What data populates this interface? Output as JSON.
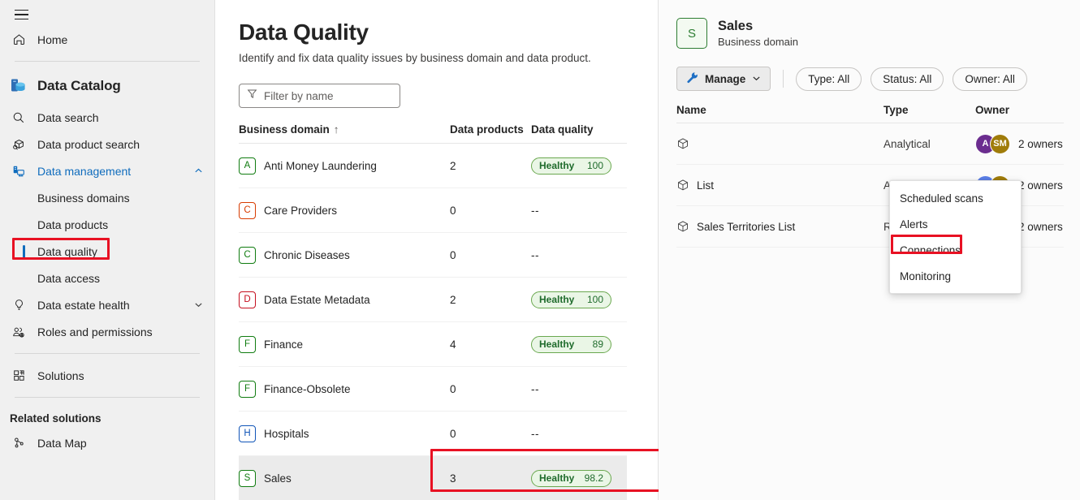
{
  "sidebar": {
    "hamburger": "menu-icon",
    "home": {
      "label": "Home",
      "icon": "home-icon"
    },
    "brand": {
      "label": "Data Catalog",
      "icon": "data-catalog-icon"
    },
    "items": [
      {
        "label": "Data search",
        "icon": "search-icon"
      },
      {
        "label": "Data product search",
        "icon": "data-product-icon"
      },
      {
        "label": "Data management",
        "icon": "data-management-icon",
        "expanded": true,
        "chevron": "chevron-up-icon"
      },
      {
        "label": "Business domains",
        "sub": true
      },
      {
        "label": "Data products",
        "sub": true
      },
      {
        "label": "Data quality",
        "sub": true,
        "selected": true,
        "highlighted": true
      },
      {
        "label": "Data access",
        "sub": true
      },
      {
        "label": "Data estate health",
        "icon": "lightbulb-icon",
        "chevron": "chevron-down-icon"
      },
      {
        "label": "Roles and permissions",
        "icon": "roles-icon"
      },
      {
        "label": "Solutions",
        "icon": "solutions-icon"
      }
    ],
    "related_solutions_header": "Related solutions",
    "related_items": [
      {
        "label": "Data Map",
        "icon": "data-map-icon"
      }
    ]
  },
  "main": {
    "title": "Data Quality",
    "subtitle": "Identify and fix data quality issues by business domain and data product.",
    "filter": {
      "placeholder": "Filter by name",
      "icon": "filter-icon",
      "value": ""
    },
    "table": {
      "columns": [
        "Business domain",
        "Data products",
        "Data quality"
      ],
      "sort_indicator": "↑",
      "rows": [
        {
          "initial": "A",
          "color": "#107c10",
          "name": "Anti Money Laundering",
          "products": "2",
          "status": "Healthy",
          "score": "100"
        },
        {
          "initial": "C",
          "color": "#d83b01",
          "name": "Care Providers",
          "products": "0",
          "status": "",
          "score": "",
          "quality": "--"
        },
        {
          "initial": "C",
          "color": "#107c10",
          "name": "Chronic Diseases",
          "products": "0",
          "status": "",
          "score": "",
          "quality": "--"
        },
        {
          "initial": "D",
          "color": "#c50f1f",
          "name": "Data Estate Metadata",
          "products": "2",
          "status": "Healthy",
          "score": "100"
        },
        {
          "initial": "F",
          "color": "#107c10",
          "name": "Finance",
          "products": "4",
          "status": "Healthy",
          "score": "89"
        },
        {
          "initial": "F",
          "color": "#107c10",
          "name": "Finance-Obsolete",
          "products": "0",
          "status": "",
          "score": "",
          "quality": "--"
        },
        {
          "initial": "H",
          "color": "#1155b8",
          "name": "Hospitals",
          "products": "0",
          "status": "",
          "score": "",
          "quality": "--"
        },
        {
          "initial": "S",
          "color": "#107c10",
          "name": "Sales",
          "products": "3",
          "status": "Healthy",
          "score": "98.2",
          "selected": true,
          "highlighted": true
        }
      ]
    }
  },
  "details": {
    "avatar_initial": "S",
    "title": "Sales",
    "subtitle": "Business domain",
    "manage_button": {
      "label": "Manage",
      "icon": "wrench-icon",
      "chevron": "chevron-down-icon"
    },
    "chips": [
      {
        "label": "Type: All"
      },
      {
        "label": "Status: All"
      },
      {
        "label": "Owner: All"
      }
    ],
    "menu": {
      "items": [
        {
          "label": "Scheduled scans"
        },
        {
          "label": "Alerts"
        },
        {
          "label": "Connections",
          "highlighted": true
        },
        {
          "label": "Monitoring"
        }
      ]
    },
    "table": {
      "columns": [
        "Name",
        "Type",
        "Owner"
      ],
      "rows": [
        {
          "name": "",
          "icon": "data-product-box-icon",
          "type": "Analytical",
          "owners": [
            {
              "initials": "A",
              "color": "#6b2d8f"
            },
            {
              "initials": "SM",
              "color": "#a07c0a"
            }
          ],
          "owner_text": "2 owners"
        },
        {
          "name": "List",
          "icon": "data-product-box-icon",
          "type": "Analytical",
          "owners": [
            {
              "initials": "ND",
              "color": "#5b7fe8"
            },
            {
              "initials": "SM",
              "color": "#a07c0a"
            }
          ],
          "owner_text": "2 owners"
        },
        {
          "name": "Sales Territories List",
          "icon": "data-product-box-icon",
          "type": "Reference",
          "owners": [
            {
              "initials": "ND",
              "color": "#5b7fe8"
            },
            {
              "initials": "SM",
              "color": "#a07c0a"
            }
          ],
          "owner_text": "2 owners"
        }
      ]
    }
  },
  "annotations": {
    "highlight_color": "#e81123"
  }
}
